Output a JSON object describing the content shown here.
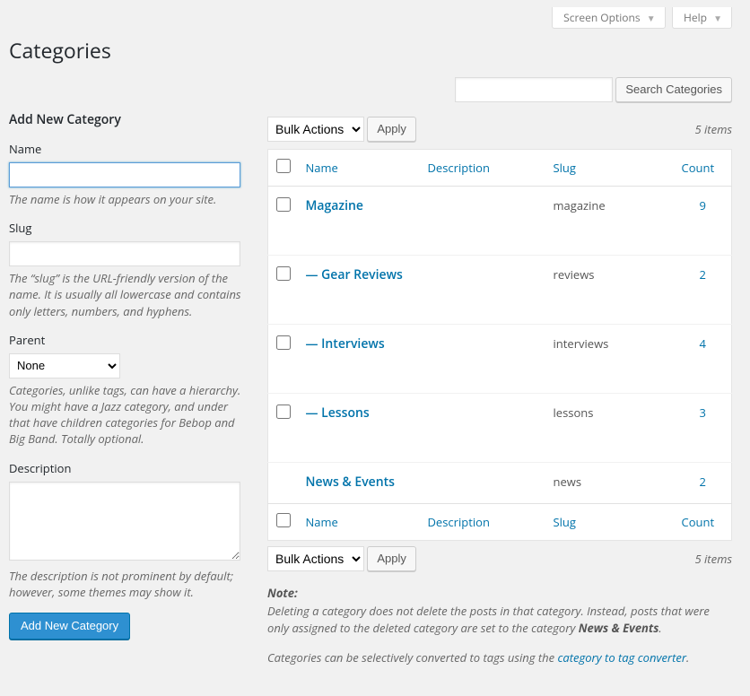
{
  "top": {
    "screen_options": "Screen Options",
    "help": "Help"
  },
  "page_title": "Categories",
  "search": {
    "button": "Search Categories",
    "value": ""
  },
  "form": {
    "title": "Add New Category",
    "name_label": "Name",
    "name_value": "",
    "name_hint": "The name is how it appears on your site.",
    "slug_label": "Slug",
    "slug_value": "",
    "slug_hint": "The “slug” is the URL-friendly version of the name. It is usually all lowercase and contains only letters, numbers, and hyphens.",
    "parent_label": "Parent",
    "parent_selected": "None",
    "parent_hint": "Categories, unlike tags, can have a hierarchy. You might have a Jazz category, and under that have children categories for Bebop and Big Band. Totally optional.",
    "description_label": "Description",
    "description_value": "",
    "description_hint": "The description is not prominent by default; however, some themes may show it.",
    "submit": "Add New Category"
  },
  "bulk": {
    "selected": "Bulk Actions",
    "apply": "Apply"
  },
  "items_count": "5 items",
  "columns": {
    "name": "Name",
    "description": "Description",
    "slug": "Slug",
    "count": "Count"
  },
  "rows": [
    {
      "name": "Magazine",
      "description": "",
      "slug": "magazine",
      "count": "9"
    },
    {
      "name": "— Gear Reviews",
      "description": "",
      "slug": "reviews",
      "count": "2"
    },
    {
      "name": "— Interviews",
      "description": "",
      "slug": "interviews",
      "count": "4"
    },
    {
      "name": "— Lessons",
      "description": "",
      "slug": "lessons",
      "count": "3"
    },
    {
      "name": "News & Events",
      "description": "",
      "slug": "news",
      "count": "2"
    }
  ],
  "note": {
    "label": "Note:",
    "delete_text_1": "Deleting a category does not delete the posts in that category. Instead, posts that were only assigned to the deleted category are set to the category ",
    "delete_text_default": "News & Events",
    "delete_text_2": ".",
    "converter_text_1": "Categories can be selectively converted to tags using the ",
    "converter_link": "category to tag converter",
    "converter_text_2": "."
  }
}
